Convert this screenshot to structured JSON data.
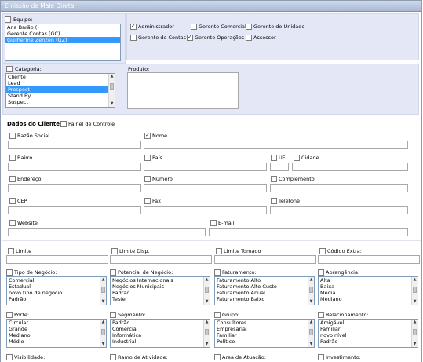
{
  "title": "Emissão de Mala Direta",
  "equipe": {
    "label": "Equipe:",
    "items": [
      "Ana Barão ()",
      "Gerente Contas (GC)",
      "Guilherme Zenzen (GZ)"
    ],
    "selected_index": 2
  },
  "roles": [
    {
      "label": "Administrador",
      "checked": true
    },
    {
      "label": "Gerente Comercial",
      "checked": false
    },
    {
      "label": "Gerente de Unidade",
      "checked": false
    },
    {
      "label": "Gerente de Contas",
      "checked": false
    },
    {
      "label": "Gerente Operações",
      "checked": true
    },
    {
      "label": "Assessor",
      "checked": false
    }
  ],
  "categoria": {
    "label": "Categoria:",
    "items": [
      "Cliente",
      "Lead",
      "Prospect",
      "Stand By",
      "Suspect"
    ],
    "selected_index": 2
  },
  "produto": {
    "label": "Produto:"
  },
  "dados_cliente": {
    "heading": "Dados do Cliente",
    "painel_label": "Painel de Controle"
  },
  "fields": {
    "razao_social": "Razão Social",
    "nome": "Nome",
    "bairro": "Bairro",
    "pais": "País",
    "uf": "UF",
    "cidade": "Cidade",
    "endereco": "Endereço",
    "numero": "Número",
    "complemento": "Complemento",
    "cep": "CEP",
    "fax": "Fax",
    "telefone": "Telefone",
    "website": "Website",
    "email": "E-mail"
  },
  "limits": {
    "limite": "Limite",
    "limite_disp": "Limite Disp.",
    "limite_tomado": "Limite Tomado",
    "codigo_extra": "Código Extra:"
  },
  "lists_row1": [
    {
      "label": "Tipo de Negócio:",
      "items": [
        "Comercial",
        "Estadual",
        "novo tipo de negócio",
        "Padrão"
      ]
    },
    {
      "label": "Potencial de Negócio:",
      "items": [
        "Negócios Internacionais",
        "Negócios Municipais",
        "Padrão",
        "Teste"
      ]
    },
    {
      "label": "Faturamento:",
      "items": [
        "Faturamento Alto",
        "Faturamento Alto Custo",
        "Faturamento Anual",
        "Faturamento Baixo"
      ]
    },
    {
      "label": "Abrangência:",
      "items": [
        "Alta",
        "Baixa",
        "Média",
        "Mediano"
      ]
    }
  ],
  "lists_row2": [
    {
      "label": "Porte:",
      "items": [
        "Circular",
        "Grande",
        "Mediano",
        "Médio"
      ]
    },
    {
      "label": "Segmento:",
      "items": [
        "Padrão",
        "Comercial",
        "Informática",
        "Industrial"
      ]
    },
    {
      "label": "Grupo:",
      "items": [
        "Consultores",
        "Empresarial",
        "Familiar",
        "Político"
      ]
    },
    {
      "label": "Relacionamento:",
      "items": [
        "Amigável",
        "Familiar",
        "novo nível",
        "Padrão"
      ]
    }
  ],
  "bottom_row": [
    "Visibilidade:",
    "Ramo de Atividade:",
    "Área de Atuação:",
    "Investimento:"
  ],
  "colors": {
    "selection": "#3399ff",
    "panel": "#e4e8f6",
    "title_bar": "#a9b8d4"
  }
}
